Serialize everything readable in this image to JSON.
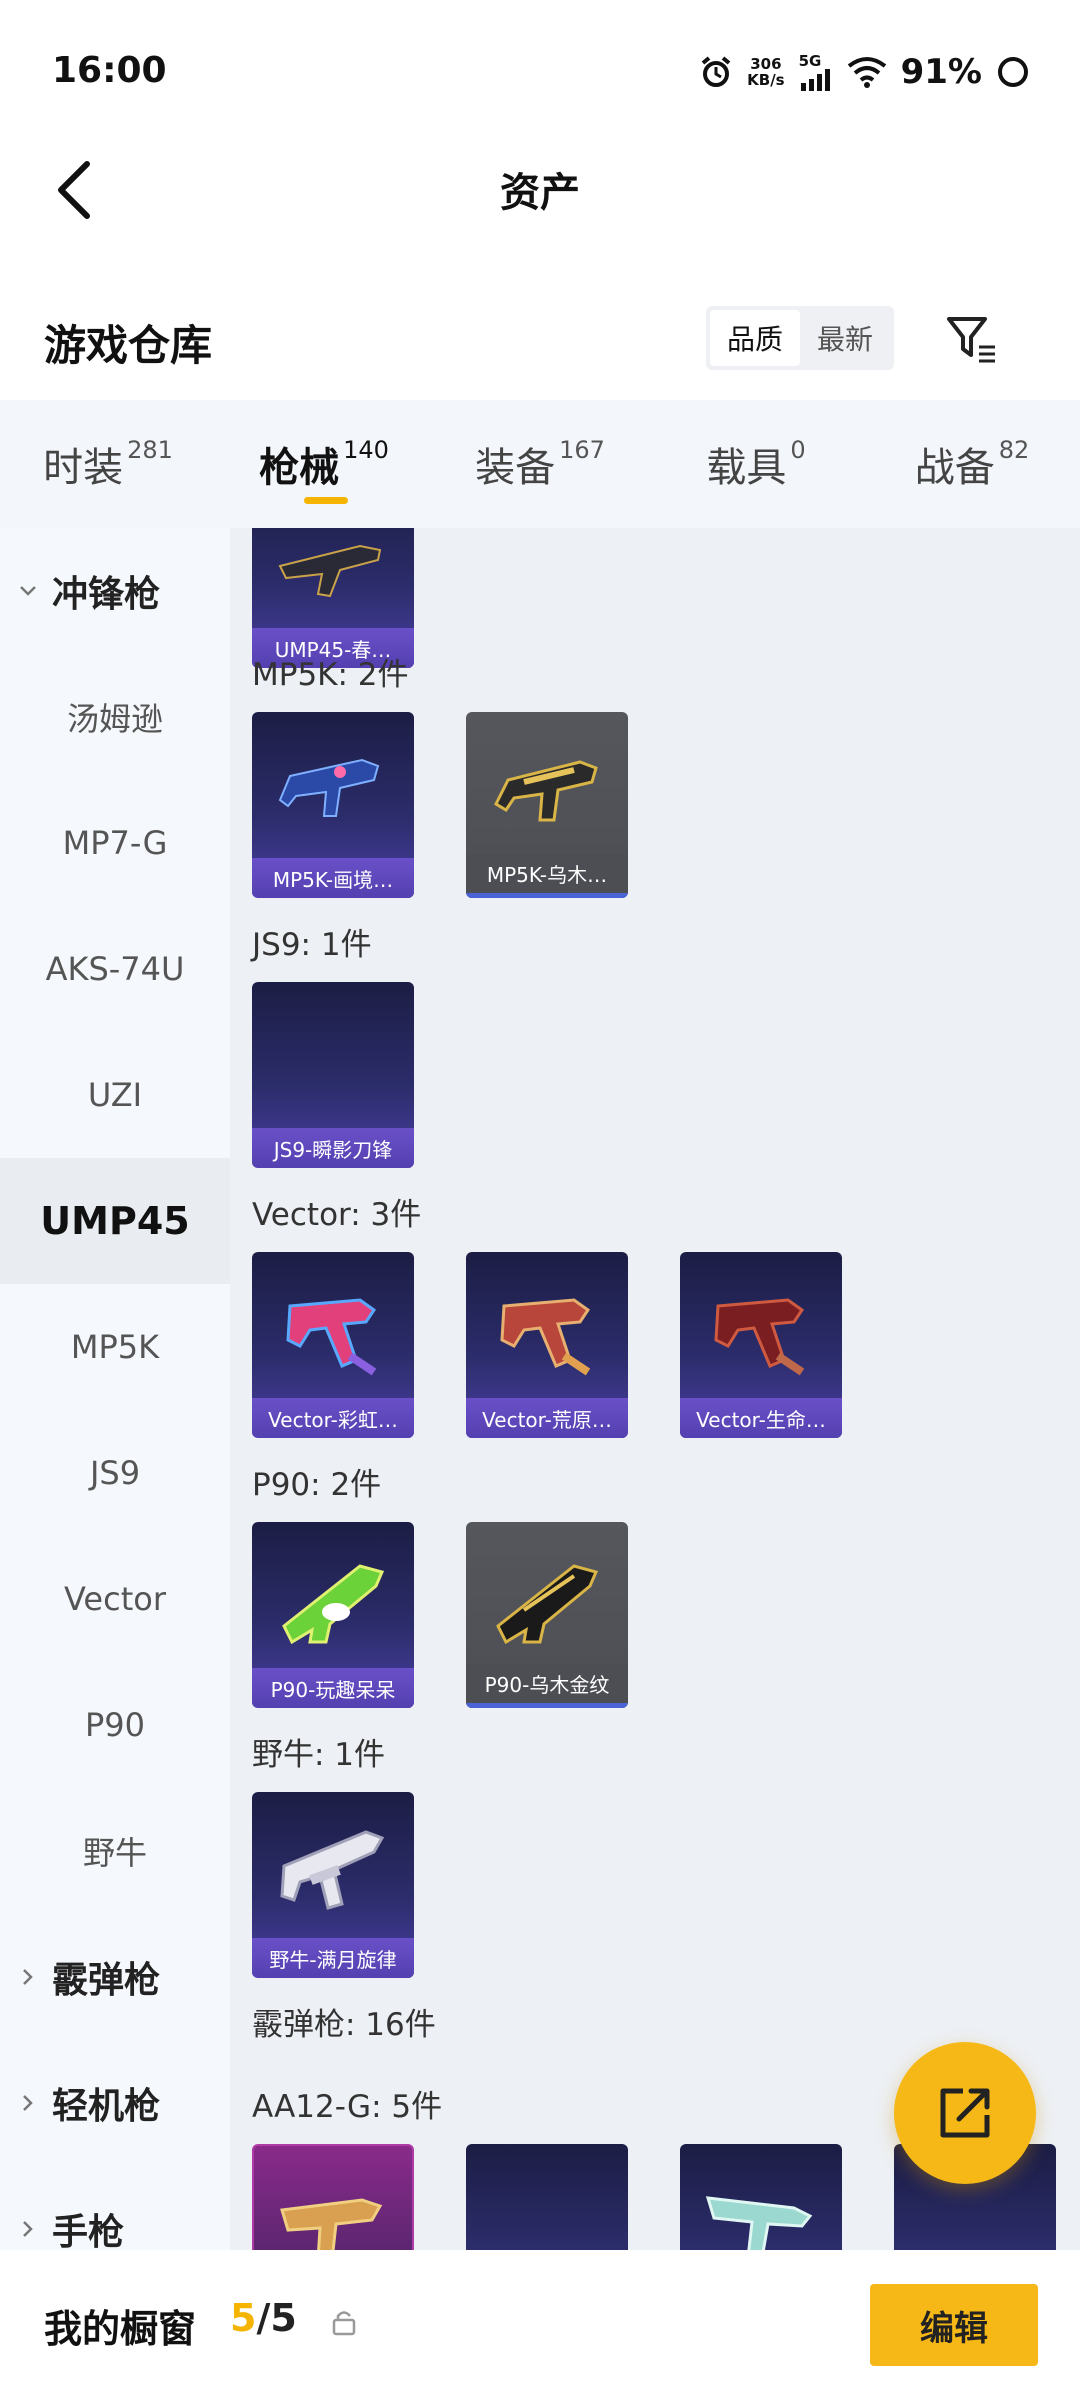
{
  "status_bar": {
    "time": "16:00",
    "speed_value": "306",
    "speed_unit": "KB/s",
    "network": "5G",
    "battery": "91%"
  },
  "header": {
    "title": "资产"
  },
  "warehouse": {
    "title": "游戏仓库",
    "sort_options": [
      "品质",
      "最新"
    ],
    "sort_selected": "品质"
  },
  "tabs": [
    {
      "label": "时装",
      "count": "281"
    },
    {
      "label": "枪械",
      "count": "140",
      "active": true
    },
    {
      "label": "装备",
      "count": "167"
    },
    {
      "label": "载具",
      "count": "0"
    },
    {
      "label": "战备",
      "count": "82"
    }
  ],
  "sidebar": {
    "group_smg": "冲锋枪",
    "items": [
      "汤姆逊",
      "MP7-G",
      "AKS-74U",
      "UZI",
      "UMP45",
      "MP5K",
      "JS9",
      "Vector",
      "P90",
      "野牛"
    ],
    "active_item": "UMP45",
    "group_shotgun": "霰弹枪",
    "group_lmg": "轻机枪",
    "group_pistol": "手枪"
  },
  "content": {
    "ump_card": "UMP45-春…",
    "mp5k_label": "MP5K: 2件",
    "mp5k_cards": [
      "MP5K-画境…",
      "MP5K-乌木…"
    ],
    "js9_label": "JS9: 1件",
    "js9_cards": [
      "JS9-瞬影刀锋"
    ],
    "vector_label": "Vector: 3件",
    "vector_cards": [
      "Vector-彩虹…",
      "Vector-荒原…",
      "Vector-生命…"
    ],
    "p90_label": "P90: 2件",
    "p90_cards": [
      "P90-玩趣呆呆",
      "P90-乌木金纹"
    ],
    "bison_label": "野牛: 1件",
    "bison_cards": [
      "野牛-满月旋律"
    ],
    "shotgun_label": "霰弹枪: 16件",
    "aa12_label": "AA12-G: 5件"
  },
  "bottom_bar": {
    "title": "我的橱窗",
    "current": "5",
    "total": "/5",
    "edit_label": "编辑"
  },
  "icons": {
    "back": "back-chevron-icon",
    "filter": "filter-icon",
    "share": "share-export-icon",
    "lock": "lock-icon"
  },
  "colors": {
    "accent": "#f6b817",
    "card_purple": "#5440b0",
    "card_gray": "#4c4e54"
  }
}
